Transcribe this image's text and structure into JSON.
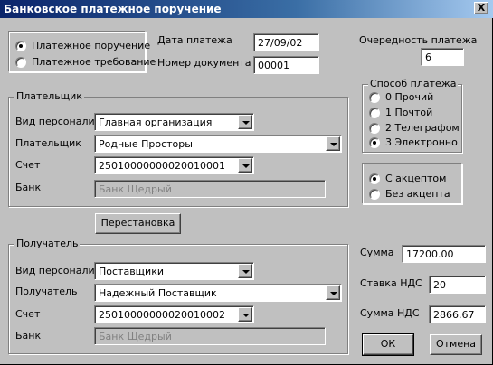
{
  "window": {
    "title": "Банковское платежное поручение",
    "close_label": "X"
  },
  "doc_type": {
    "options": [
      {
        "label": "Платежное поручение",
        "selected": true
      },
      {
        "label": "Платежное требование",
        "selected": false
      }
    ]
  },
  "header": {
    "date_label": "Дата платежа",
    "date_value": "27/09/02",
    "number_label": "Номер документа",
    "number_value": "00001",
    "priority_label": "Очередность платежа",
    "priority_value": "6"
  },
  "payer": {
    "caption": "Плательщик",
    "personnel_label": "Вид персоналии",
    "personnel_value": "Главная организация",
    "payer_label": "Плательщик",
    "payer_value": "Родные Просторы",
    "account_label": "Счет",
    "account_value": "25010000000020010001",
    "bank_label": "Банк",
    "bank_value": "Банк Щедрый"
  },
  "swap_button": "Перестановка",
  "recipient": {
    "caption": "Получатель",
    "personnel_label": "Вид персоналии",
    "personnel_value": "Поставщики",
    "recipient_label": "Получатель",
    "recipient_value": "Надежный Поставщик",
    "account_label": "Счет",
    "account_value": "25010000000020010002",
    "bank_label": "Банк",
    "bank_value": "Банк Щедрый"
  },
  "payment_method": {
    "caption": "Способ платежа",
    "options": [
      {
        "label": "0 Прочий",
        "selected": false
      },
      {
        "label": "1 Почтой",
        "selected": false
      },
      {
        "label": "2 Телеграфом",
        "selected": false
      },
      {
        "label": "3 Электронно",
        "selected": true
      }
    ]
  },
  "acceptance": {
    "options": [
      {
        "label": "С акцептом",
        "selected": true
      },
      {
        "label": "Без акцепта",
        "selected": false
      }
    ]
  },
  "totals": {
    "sum_label": "Сумма",
    "sum_value": "17200.00",
    "vat_rate_label": "Ставка НДС",
    "vat_rate_value": "20",
    "vat_sum_label": "Сумма НДС",
    "vat_sum_value": "2866.67"
  },
  "buttons": {
    "ok": "ОК",
    "cancel": "Отмена"
  }
}
